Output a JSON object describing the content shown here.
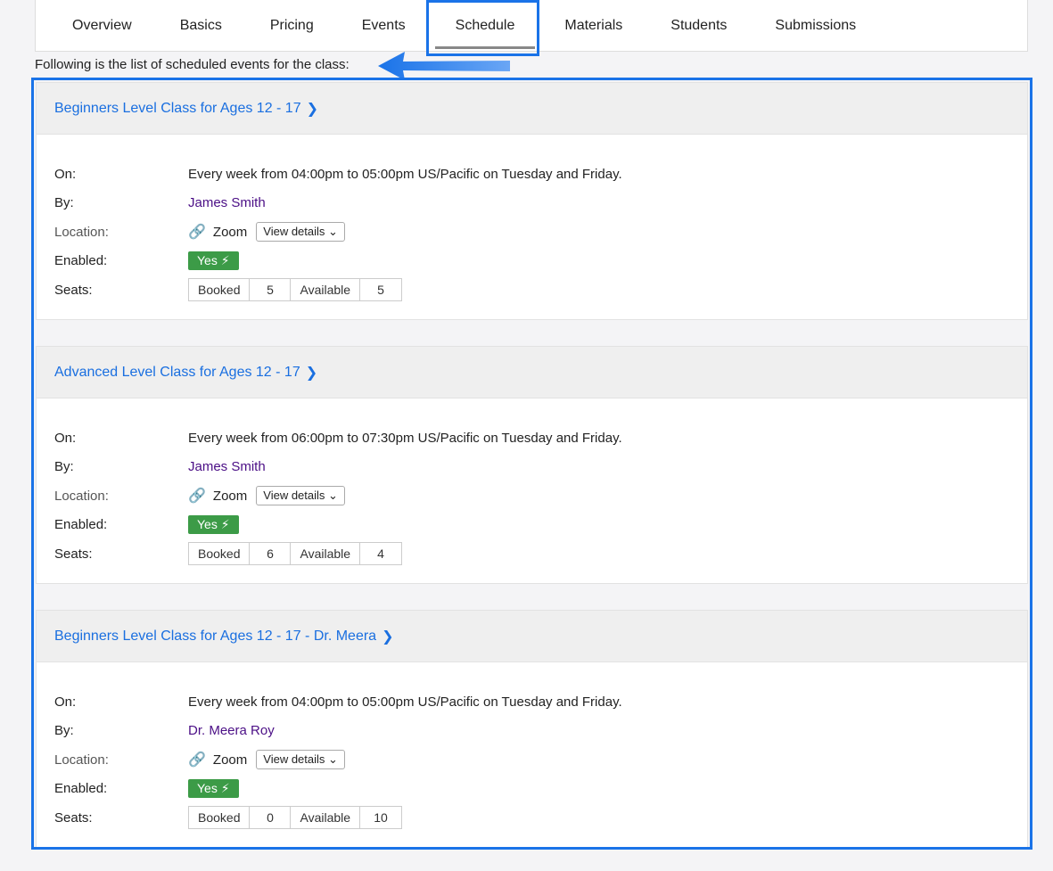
{
  "tabs": [
    {
      "label": "Overview"
    },
    {
      "label": "Basics"
    },
    {
      "label": "Pricing"
    },
    {
      "label": "Events"
    },
    {
      "label": "Schedule"
    },
    {
      "label": "Materials"
    },
    {
      "label": "Students"
    },
    {
      "label": "Submissions"
    }
  ],
  "active_tab": "Schedule",
  "intro_text": "Following is the list of scheduled events for the class:",
  "labels": {
    "on": "On:",
    "by": "By:",
    "location": "Location:",
    "enabled": "Enabled:",
    "seats": "Seats:",
    "booked": "Booked",
    "available": "Available",
    "view_details": "View details",
    "yes": "Yes"
  },
  "events": [
    {
      "title": "Beginners Level Class for Ages 12 - 17",
      "schedule": "Every week from 04:00pm to 05:00pm US/Pacific on Tuesday and Friday.",
      "instructor": "James Smith",
      "location": "Zoom",
      "booked": "5",
      "available": "5"
    },
    {
      "title": "Advanced Level Class for Ages 12 - 17",
      "schedule": "Every week from 06:00pm to 07:30pm US/Pacific on Tuesday and Friday.",
      "instructor": "James Smith",
      "location": "Zoom",
      "booked": "6",
      "available": "4"
    },
    {
      "title": "Beginners Level Class for Ages 12 - 17 - Dr. Meera",
      "schedule": "Every week from 04:00pm to 05:00pm US/Pacific on Tuesday and Friday.",
      "instructor": "Dr. Meera Roy",
      "location": "Zoom",
      "booked": "0",
      "available": "10"
    }
  ],
  "colors": {
    "accent": "#1a73e8",
    "link": "#1a6fe0",
    "instructor": "#4b0f86",
    "enabled_badge": "#3c9b47"
  }
}
